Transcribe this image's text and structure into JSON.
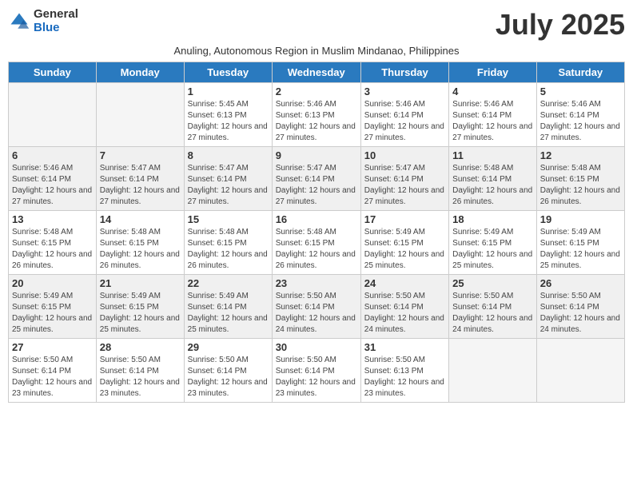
{
  "logo": {
    "general": "General",
    "blue": "Blue"
  },
  "title": "July 2025",
  "subtitle": "Anuling, Autonomous Region in Muslim Mindanao, Philippines",
  "days_of_week": [
    "Sunday",
    "Monday",
    "Tuesday",
    "Wednesday",
    "Thursday",
    "Friday",
    "Saturday"
  ],
  "weeks": [
    [
      {
        "day": "",
        "info": ""
      },
      {
        "day": "",
        "info": ""
      },
      {
        "day": "1",
        "info": "Sunrise: 5:45 AM\nSunset: 6:13 PM\nDaylight: 12 hours and 27 minutes."
      },
      {
        "day": "2",
        "info": "Sunrise: 5:46 AM\nSunset: 6:13 PM\nDaylight: 12 hours and 27 minutes."
      },
      {
        "day": "3",
        "info": "Sunrise: 5:46 AM\nSunset: 6:14 PM\nDaylight: 12 hours and 27 minutes."
      },
      {
        "day": "4",
        "info": "Sunrise: 5:46 AM\nSunset: 6:14 PM\nDaylight: 12 hours and 27 minutes."
      },
      {
        "day": "5",
        "info": "Sunrise: 5:46 AM\nSunset: 6:14 PM\nDaylight: 12 hours and 27 minutes."
      }
    ],
    [
      {
        "day": "6",
        "info": "Sunrise: 5:46 AM\nSunset: 6:14 PM\nDaylight: 12 hours and 27 minutes."
      },
      {
        "day": "7",
        "info": "Sunrise: 5:47 AM\nSunset: 6:14 PM\nDaylight: 12 hours and 27 minutes."
      },
      {
        "day": "8",
        "info": "Sunrise: 5:47 AM\nSunset: 6:14 PM\nDaylight: 12 hours and 27 minutes."
      },
      {
        "day": "9",
        "info": "Sunrise: 5:47 AM\nSunset: 6:14 PM\nDaylight: 12 hours and 27 minutes."
      },
      {
        "day": "10",
        "info": "Sunrise: 5:47 AM\nSunset: 6:14 PM\nDaylight: 12 hours and 27 minutes."
      },
      {
        "day": "11",
        "info": "Sunrise: 5:48 AM\nSunset: 6:14 PM\nDaylight: 12 hours and 26 minutes."
      },
      {
        "day": "12",
        "info": "Sunrise: 5:48 AM\nSunset: 6:15 PM\nDaylight: 12 hours and 26 minutes."
      }
    ],
    [
      {
        "day": "13",
        "info": "Sunrise: 5:48 AM\nSunset: 6:15 PM\nDaylight: 12 hours and 26 minutes."
      },
      {
        "day": "14",
        "info": "Sunrise: 5:48 AM\nSunset: 6:15 PM\nDaylight: 12 hours and 26 minutes."
      },
      {
        "day": "15",
        "info": "Sunrise: 5:48 AM\nSunset: 6:15 PM\nDaylight: 12 hours and 26 minutes."
      },
      {
        "day": "16",
        "info": "Sunrise: 5:48 AM\nSunset: 6:15 PM\nDaylight: 12 hours and 26 minutes."
      },
      {
        "day": "17",
        "info": "Sunrise: 5:49 AM\nSunset: 6:15 PM\nDaylight: 12 hours and 25 minutes."
      },
      {
        "day": "18",
        "info": "Sunrise: 5:49 AM\nSunset: 6:15 PM\nDaylight: 12 hours and 25 minutes."
      },
      {
        "day": "19",
        "info": "Sunrise: 5:49 AM\nSunset: 6:15 PM\nDaylight: 12 hours and 25 minutes."
      }
    ],
    [
      {
        "day": "20",
        "info": "Sunrise: 5:49 AM\nSunset: 6:15 PM\nDaylight: 12 hours and 25 minutes."
      },
      {
        "day": "21",
        "info": "Sunrise: 5:49 AM\nSunset: 6:15 PM\nDaylight: 12 hours and 25 minutes."
      },
      {
        "day": "22",
        "info": "Sunrise: 5:49 AM\nSunset: 6:14 PM\nDaylight: 12 hours and 25 minutes."
      },
      {
        "day": "23",
        "info": "Sunrise: 5:50 AM\nSunset: 6:14 PM\nDaylight: 12 hours and 24 minutes."
      },
      {
        "day": "24",
        "info": "Sunrise: 5:50 AM\nSunset: 6:14 PM\nDaylight: 12 hours and 24 minutes."
      },
      {
        "day": "25",
        "info": "Sunrise: 5:50 AM\nSunset: 6:14 PM\nDaylight: 12 hours and 24 minutes."
      },
      {
        "day": "26",
        "info": "Sunrise: 5:50 AM\nSunset: 6:14 PM\nDaylight: 12 hours and 24 minutes."
      }
    ],
    [
      {
        "day": "27",
        "info": "Sunrise: 5:50 AM\nSunset: 6:14 PM\nDaylight: 12 hours and 23 minutes."
      },
      {
        "day": "28",
        "info": "Sunrise: 5:50 AM\nSunset: 6:14 PM\nDaylight: 12 hours and 23 minutes."
      },
      {
        "day": "29",
        "info": "Sunrise: 5:50 AM\nSunset: 6:14 PM\nDaylight: 12 hours and 23 minutes."
      },
      {
        "day": "30",
        "info": "Sunrise: 5:50 AM\nSunset: 6:14 PM\nDaylight: 12 hours and 23 minutes."
      },
      {
        "day": "31",
        "info": "Sunrise: 5:50 AM\nSunset: 6:13 PM\nDaylight: 12 hours and 23 minutes."
      },
      {
        "day": "",
        "info": ""
      },
      {
        "day": "",
        "info": ""
      }
    ]
  ]
}
